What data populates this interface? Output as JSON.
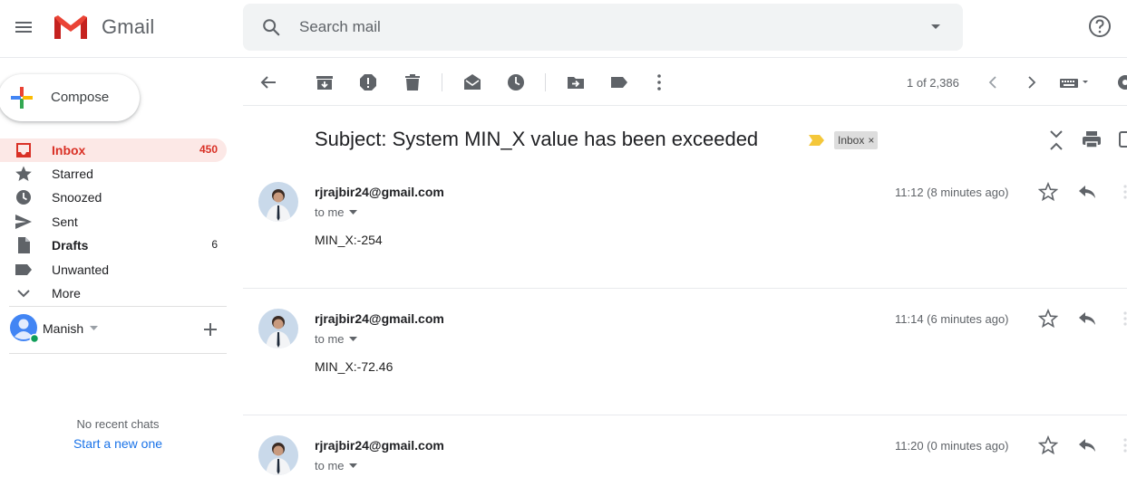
{
  "header": {
    "app_name": "Gmail",
    "search_placeholder": "Search mail",
    "icons": [
      "menu-icon",
      "gmail-logo",
      "search-icon",
      "search-options-icon",
      "help-icon"
    ]
  },
  "sidebar": {
    "compose_label": "Compose",
    "items": [
      {
        "label": "Inbox",
        "count": "450",
        "icon": "inbox-icon",
        "active": true
      },
      {
        "label": "Starred",
        "count": "",
        "icon": "star-icon"
      },
      {
        "label": "Snoozed",
        "count": "",
        "icon": "clock-icon"
      },
      {
        "label": "Sent",
        "count": "",
        "icon": "send-icon"
      },
      {
        "label": "Drafts",
        "count": "6",
        "icon": "draft-icon"
      },
      {
        "label": "Unwanted",
        "count": "",
        "icon": "label-icon"
      },
      {
        "label": "More",
        "count": "",
        "icon": "chevron-down-icon"
      }
    ],
    "user_name": "Manish",
    "no_chats": "No recent chats",
    "start_chat": "Start a new one"
  },
  "toolbar": {
    "pagination": "1 of 2,386",
    "icons": [
      "back-icon",
      "archive-icon",
      "report-spam-icon",
      "delete-icon",
      "mark-unread-icon",
      "snooze-icon",
      "move-to-icon",
      "labels-icon",
      "more-vert-icon",
      "newer-icon",
      "older-icon",
      "input-tools-icon",
      "settings-icon"
    ]
  },
  "thread": {
    "subject": "Subject: System MIN_X value has been exceeded",
    "label": "Inbox",
    "label_remove": "×",
    "messages": [
      {
        "sender": "rjrajbir24@gmail.com",
        "to": "to me",
        "time": "11:12 (8 minutes ago)",
        "body": "MIN_X:-254"
      },
      {
        "sender": "rjrajbir24@gmail.com",
        "to": "to me",
        "time": "11:14 (6 minutes ago)",
        "body": "MIN_X:-72.46"
      },
      {
        "sender": "rjrajbir24@gmail.com",
        "to": "to me",
        "time": "11:20 (0 minutes ago)",
        "body": ""
      }
    ]
  },
  "colors": {
    "accent_red": "#d93025",
    "inbox_active_bg": "#fce8e6",
    "search_bg": "#f1f3f4",
    "link_blue": "#1a73e8",
    "important_marker": "#f4c73a"
  }
}
